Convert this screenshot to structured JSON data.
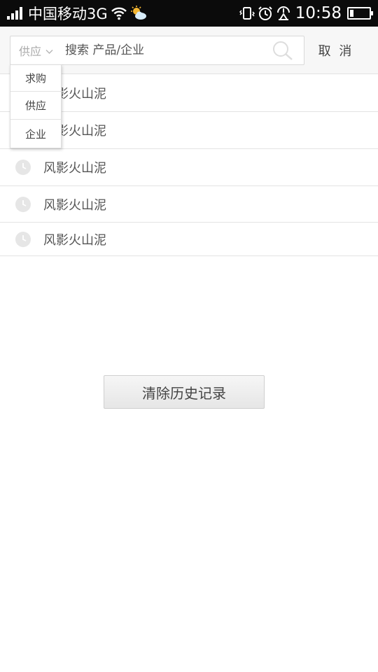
{
  "status_bar": {
    "carrier": "中国移动3G",
    "time": "10:58",
    "battery_level": 0.2,
    "icons": [
      "signal-icon",
      "wifi-icon",
      "weather-icon",
      "vibrate-icon",
      "alarm-icon",
      "clock-icon",
      "battery-icon"
    ]
  },
  "search": {
    "category_selected": "供应",
    "placeholder": "搜索 产品/企业",
    "cancel_label": "取 消"
  },
  "dropdown": {
    "options": [
      "求购",
      "供应",
      "企业"
    ]
  },
  "history": {
    "items": [
      "风影火山泥",
      "风影火山泥",
      "风影火山泥",
      "风影火山泥",
      "风影火山泥"
    ]
  },
  "clear_label": "清除历史记录",
  "colors": {
    "status_bar_bg": "#0b0b0b",
    "header_bg": "#f7f7f7",
    "divider": "#e3e3e3",
    "text": "#555555",
    "muted": "#aaaaaa",
    "clock_icon": "#e6e6e6"
  }
}
